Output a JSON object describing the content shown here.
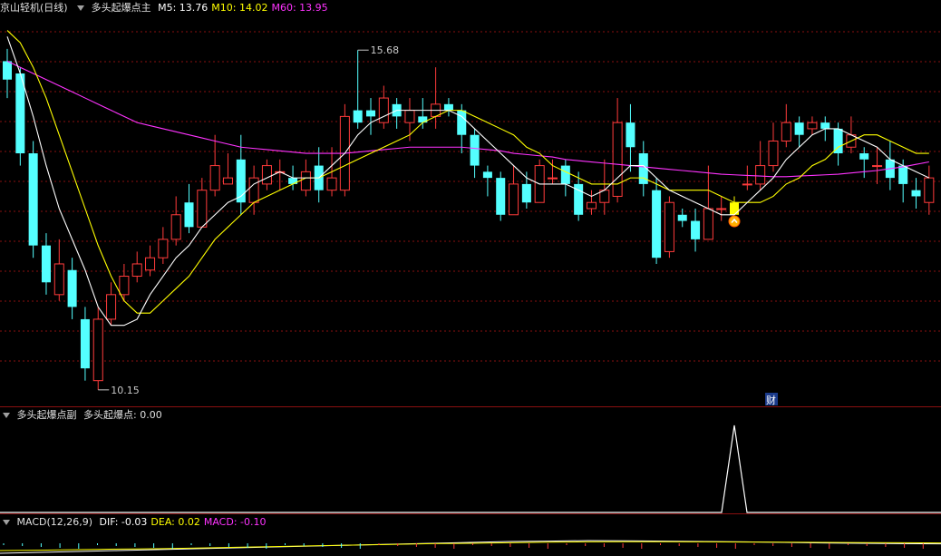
{
  "main_panel": {
    "title": "京山轻机(日线)",
    "indicator": "多头起爆点主",
    "ma_items": [
      {
        "label": "M5: 13.76",
        "color": "#ffffff"
      },
      {
        "label": "M10: 14.02",
        "color": "#ffff00"
      },
      {
        "label": "M60: 13.95",
        "color": "#ff33ff"
      }
    ],
    "high_label": "15.68",
    "low_label": "10.15",
    "cai_badge": "财",
    "signal_icon": "up-chevron-icon"
  },
  "sub_panel": {
    "title": "多头起爆点副",
    "value_label": "多头起爆点: 0.00"
  },
  "macd_panel": {
    "title": "MACD(12,26,9)",
    "items": [
      {
        "label": "DIF: -0.03",
        "color": "#ffffff"
      },
      {
        "label": "DEA: 0.02",
        "color": "#ffff00"
      },
      {
        "label": "MACD: -0.10",
        "color": "#ff33ff"
      }
    ]
  },
  "colors": {
    "up": "#ff3b3b",
    "down": "#54ffff",
    "signal": "#ffff00",
    "grid": "#8a1010"
  },
  "chart_data": [
    {
      "type": "candlestick",
      "title": "京山轻机(日线)",
      "ylim": [
        10.0,
        16.2
      ],
      "annotations": [
        {
          "text": "15.68",
          "value": 15.68
        },
        {
          "text": "10.15",
          "value": 10.15
        }
      ],
      "candles": [
        [
          15.5,
          15.2,
          15.7,
          14.9
        ],
        [
          15.3,
          14.0,
          15.4,
          13.8
        ],
        [
          14.0,
          12.5,
          14.2,
          12.3
        ],
        [
          12.5,
          11.9,
          12.7,
          11.7
        ],
        [
          11.7,
          12.2,
          12.6,
          11.6
        ],
        [
          12.1,
          11.5,
          12.3,
          11.3
        ],
        [
          11.3,
          10.5,
          11.5,
          10.3
        ],
        [
          10.3,
          11.3,
          11.5,
          10.15
        ],
        [
          11.3,
          11.7,
          11.9,
          11.2
        ],
        [
          11.7,
          12.0,
          12.2,
          11.6
        ],
        [
          12.0,
          12.2,
          12.4,
          11.9
        ],
        [
          12.1,
          12.3,
          12.5,
          12.0
        ],
        [
          12.3,
          12.6,
          12.8,
          12.2
        ],
        [
          12.6,
          13.0,
          13.3,
          12.5
        ],
        [
          13.2,
          12.8,
          13.5,
          12.7
        ],
        [
          12.8,
          13.4,
          13.6,
          12.8
        ],
        [
          13.4,
          13.8,
          14.3,
          13.3
        ],
        [
          13.5,
          13.6,
          14.0,
          13.5
        ],
        [
          13.9,
          13.2,
          14.3,
          13.0
        ],
        [
          13.2,
          13.6,
          13.8,
          13.0
        ],
        [
          13.5,
          13.8,
          13.9,
          13.4
        ],
        [
          13.7,
          13.7,
          13.9,
          13.4
        ],
        [
          13.6,
          13.5,
          13.8,
          13.4
        ],
        [
          13.4,
          13.7,
          13.9,
          13.3
        ],
        [
          13.8,
          13.4,
          14.1,
          13.2
        ],
        [
          13.4,
          13.6,
          14.1,
          13.3
        ],
        [
          13.4,
          14.6,
          14.8,
          13.3
        ],
        [
          14.7,
          14.5,
          15.68,
          14.4
        ],
        [
          14.7,
          14.6,
          14.9,
          14.3
        ],
        [
          14.5,
          14.9,
          15.1,
          14.4
        ],
        [
          14.8,
          14.6,
          14.9,
          14.4
        ],
        [
          14.5,
          14.7,
          14.9,
          14.2
        ],
        [
          14.6,
          14.5,
          14.9,
          14.4
        ],
        [
          14.6,
          14.8,
          15.4,
          14.4
        ],
        [
          14.8,
          14.7,
          14.9,
          14.6
        ],
        [
          14.7,
          14.3,
          14.8,
          14.0
        ],
        [
          14.3,
          13.8,
          14.4,
          13.6
        ],
        [
          13.7,
          13.6,
          13.8,
          13.3
        ],
        [
          13.6,
          13.0,
          13.7,
          12.9
        ],
        [
          13.0,
          13.5,
          13.8,
          13.0
        ],
        [
          13.5,
          13.2,
          13.7,
          13.1
        ],
        [
          13.2,
          13.8,
          13.9,
          13.2
        ],
        [
          13.6,
          13.6,
          13.9,
          13.5
        ],
        [
          13.8,
          13.5,
          13.9,
          13.3
        ],
        [
          13.5,
          13.0,
          13.7,
          12.9
        ],
        [
          13.1,
          13.2,
          13.4,
          13.0
        ],
        [
          13.2,
          13.4,
          13.9,
          13.0
        ],
        [
          13.3,
          14.5,
          14.9,
          13.2
        ],
        [
          14.5,
          14.1,
          14.8,
          13.7
        ],
        [
          14.0,
          13.5,
          14.2,
          13.3
        ],
        [
          13.4,
          12.3,
          13.6,
          12.2
        ],
        [
          12.4,
          13.2,
          13.3,
          12.3
        ],
        [
          13.0,
          12.9,
          13.1,
          12.8
        ],
        [
          12.9,
          12.6,
          13.1,
          12.4
        ],
        [
          12.6,
          13.1,
          13.8,
          12.6
        ],
        [
          13.1,
          13.1,
          13.3,
          12.9
        ],
        [
          13.0,
          13.2,
          13.3,
          13.1
        ],
        [
          13.5,
          13.5,
          13.8,
          13.4
        ],
        [
          13.5,
          13.8,
          14.2,
          13.4
        ],
        [
          13.8,
          14.2,
          14.5,
          13.7
        ],
        [
          14.2,
          14.5,
          14.8,
          14.1
        ],
        [
          14.5,
          14.3,
          14.6,
          14.1
        ],
        [
          14.4,
          14.5,
          14.6,
          14.3
        ],
        [
          14.5,
          14.4,
          14.6,
          14.2
        ],
        [
          14.4,
          14.0,
          14.5,
          13.8
        ],
        [
          14.1,
          14.3,
          14.6,
          14.0
        ],
        [
          14.0,
          13.9,
          14.1,
          13.6
        ],
        [
          13.8,
          13.8,
          14.1,
          13.5
        ],
        [
          13.9,
          13.6,
          14.2,
          13.4
        ],
        [
          13.8,
          13.5,
          13.9,
          13.2
        ],
        [
          13.4,
          13.3,
          13.6,
          13.1
        ],
        [
          13.2,
          13.6,
          13.8,
          13.0
        ]
      ],
      "signal_index": 56,
      "ma5": [
        15.9,
        15.3,
        14.6,
        13.8,
        13.1,
        12.6,
        12.1,
        11.5,
        11.2,
        11.2,
        11.3,
        11.7,
        12.0,
        12.3,
        12.5,
        12.8,
        13.0,
        13.2,
        13.3,
        13.5,
        13.6,
        13.7,
        13.6,
        13.6,
        13.6,
        13.8,
        14.0,
        14.3,
        14.5,
        14.6,
        14.7,
        14.7,
        14.7,
        14.7,
        14.7,
        14.6,
        14.4,
        14.2,
        14.0,
        13.8,
        13.6,
        13.5,
        13.5,
        13.5,
        13.4,
        13.3,
        13.4,
        13.6,
        13.8,
        13.8,
        13.6,
        13.4,
        13.3,
        13.2,
        13.1,
        13.0,
        13.0,
        13.2,
        13.4,
        13.6,
        13.9,
        14.1,
        14.3,
        14.4,
        14.4,
        14.3,
        14.2,
        14.1,
        13.9,
        13.8,
        13.7,
        13.6
      ],
      "ma10": [
        16.0,
        15.8,
        15.4,
        14.9,
        14.3,
        13.7,
        13.1,
        12.5,
        12.0,
        11.6,
        11.4,
        11.4,
        11.6,
        11.8,
        12.0,
        12.3,
        12.6,
        12.8,
        13.0,
        13.2,
        13.3,
        13.4,
        13.5,
        13.6,
        13.6,
        13.7,
        13.8,
        13.9,
        14.0,
        14.1,
        14.2,
        14.3,
        14.5,
        14.6,
        14.7,
        14.7,
        14.6,
        14.5,
        14.4,
        14.3,
        14.1,
        14.0,
        13.8,
        13.7,
        13.6,
        13.5,
        13.5,
        13.5,
        13.6,
        13.6,
        13.5,
        13.4,
        13.4,
        13.4,
        13.4,
        13.3,
        13.2,
        13.2,
        13.2,
        13.3,
        13.5,
        13.6,
        13.8,
        13.9,
        14.1,
        14.2,
        14.3,
        14.3,
        14.2,
        14.1,
        14.0,
        14.0
      ],
      "ma60": [
        15.5,
        15.4,
        15.3,
        15.2,
        15.1,
        15.0,
        14.9,
        14.8,
        14.7,
        14.6,
        14.5,
        14.45,
        14.4,
        14.35,
        14.3,
        14.25,
        14.2,
        14.15,
        14.1,
        14.08,
        14.06,
        14.04,
        14.02,
        14.0,
        14.0,
        14.0,
        14.0,
        14.02,
        14.04,
        14.06,
        14.08,
        14.1,
        14.1,
        14.1,
        14.1,
        14.1,
        14.08,
        14.06,
        14.04,
        14.0,
        13.98,
        13.96,
        13.94,
        13.9,
        13.88,
        13.86,
        13.84,
        13.82,
        13.8,
        13.78,
        13.76,
        13.74,
        13.72,
        13.7,
        13.68,
        13.66,
        13.65,
        13.64,
        13.63,
        13.62,
        13.62,
        13.63,
        13.64,
        13.65,
        13.66,
        13.68,
        13.7,
        13.72,
        13.75,
        13.78,
        13.82,
        13.86
      ]
    },
    {
      "type": "line",
      "title": "多头起爆点副",
      "series": [
        {
          "name": "多头起爆点",
          "spike_index": 56,
          "spike_value": 1,
          "baseline": 0
        }
      ],
      "ylim": [
        0,
        1
      ]
    },
    {
      "type": "line",
      "title": "MACD(12,26,9)",
      "series": [
        {
          "name": "DIF",
          "values": [
            -0.55,
            -0.5,
            -0.45,
            -0.4,
            -0.35,
            -0.3,
            -0.25,
            -0.2,
            -0.15,
            -0.1,
            -0.05,
            0.0,
            0.05,
            0.1,
            0.12,
            0.15,
            0.14,
            0.12,
            0.1,
            0.08,
            0.05,
            0.02,
            0.0,
            -0.02,
            -0.03
          ]
        },
        {
          "name": "DEA",
          "values": [
            -0.4,
            -0.38,
            -0.35,
            -0.32,
            -0.3,
            -0.26,
            -0.22,
            -0.18,
            -0.14,
            -0.1,
            -0.06,
            -0.02,
            0.0,
            0.03,
            0.06,
            0.08,
            0.09,
            0.09,
            0.08,
            0.07,
            0.06,
            0.05,
            0.04,
            0.03,
            0.02
          ]
        }
      ],
      "ylim": [
        -0.6,
        0.6
      ]
    }
  ]
}
